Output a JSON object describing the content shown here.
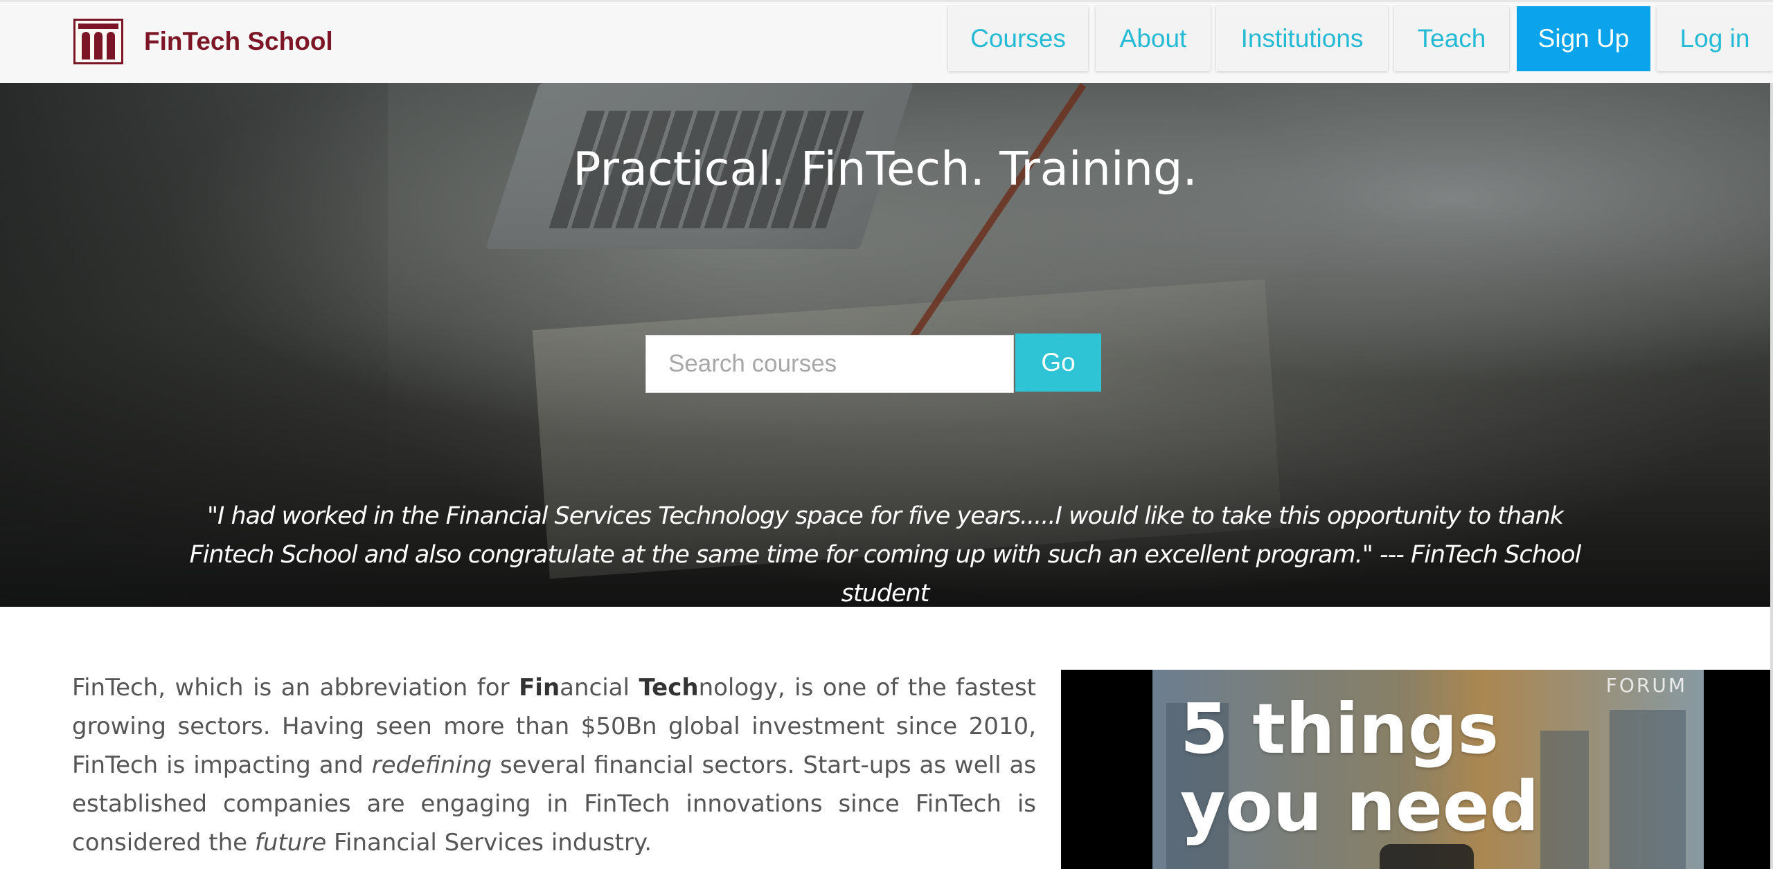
{
  "brand": {
    "name": "FinTech School"
  },
  "nav": {
    "courses": "Courses",
    "about": "About",
    "institutions": "Institutions",
    "teach": "Teach",
    "signup": "Sign Up",
    "login": "Log in"
  },
  "hero": {
    "title": "Practical. FinTech. Training.",
    "search_placeholder": "Search courses",
    "go_label": "Go",
    "quote": "\"I had worked in the Financial Services Technology space for five years.....I would like to take this opportunity to thank Fintech School and also congratulate at the same time for coming up with such an excellent program.\" --- FinTech School student"
  },
  "intro": {
    "p1": "FinTech, which is an abbreviation for ",
    "fin": "Fin",
    "ancial": "ancial ",
    "tech": "Tech",
    "p2": "nology, is one of the fastest growing sectors. Having seen more than $50Bn global investment since 2010, FinTech is impacting and ",
    "redefining": "redefining",
    "p3": " several financial sectors. Start-ups as well as established companies are engaging in FinTech innovations since FinTech is considered the ",
    "future": "future",
    "p4": " Financial Services industry."
  },
  "video": {
    "watermark": "FORUM",
    "title_line1": "5 things",
    "title_line2": "you need",
    "icon": "play-icon"
  },
  "colors": {
    "brand": "#7c1626",
    "link": "#24b9d4",
    "signup_bg": "#0aa3ec",
    "go_bg": "#2ec4d6"
  }
}
